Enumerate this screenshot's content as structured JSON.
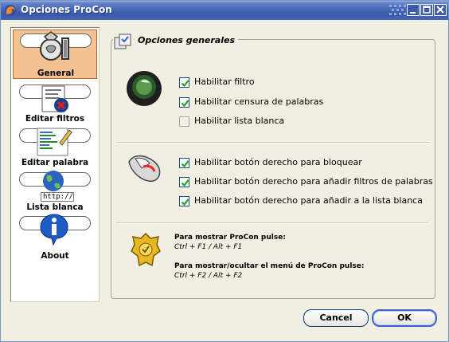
{
  "window": {
    "title": "Opciones ProCon"
  },
  "sidebar": {
    "items": [
      {
        "label": "General",
        "icon": "procon-tool-icon",
        "selected": true
      },
      {
        "label": "Editar filtros",
        "icon": "filter-edit-icon",
        "selected": false
      },
      {
        "label": "Editar palabra",
        "icon": "word-list-icon",
        "selected": false
      },
      {
        "label": "Lista blanca",
        "icon": "globe-url-icon",
        "url_text": "http://",
        "selected": false
      },
      {
        "label": "About",
        "icon": "info-icon",
        "selected": false
      }
    ]
  },
  "main": {
    "title": "Opciones generales",
    "filter_section": {
      "options": [
        {
          "label": "Habilitar filtro",
          "checked": true
        },
        {
          "label": "Habilitar censura de palabras",
          "checked": true
        },
        {
          "label": "Habilitar lista blanca",
          "checked": false
        }
      ]
    },
    "mouse_section": {
      "options": [
        {
          "label": "Habilitar botón derecho para bloquear",
          "checked": true
        },
        {
          "label": "Habilitar botón derecho para añadir filtros de palabras",
          "checked": true
        },
        {
          "label": "Habilitar botón derecho para añadir a la lista blanca",
          "checked": true
        }
      ]
    },
    "hotkeys": {
      "show_label": "Para mostrar ProCon pulse:",
      "show_keys": "Ctrl + F1 / Alt + F1",
      "toggle_label": "Para mostrar/ocultar el menú de ProCon pulse:",
      "toggle_keys": "Ctrl + F2 / Alt + F2"
    }
  },
  "buttons": {
    "cancel": "Cancel",
    "ok": "OK"
  },
  "colors": {
    "titlebar": "#3c59a9",
    "selected_bg": "#f4c192",
    "checkbox_check": "#21a121"
  }
}
